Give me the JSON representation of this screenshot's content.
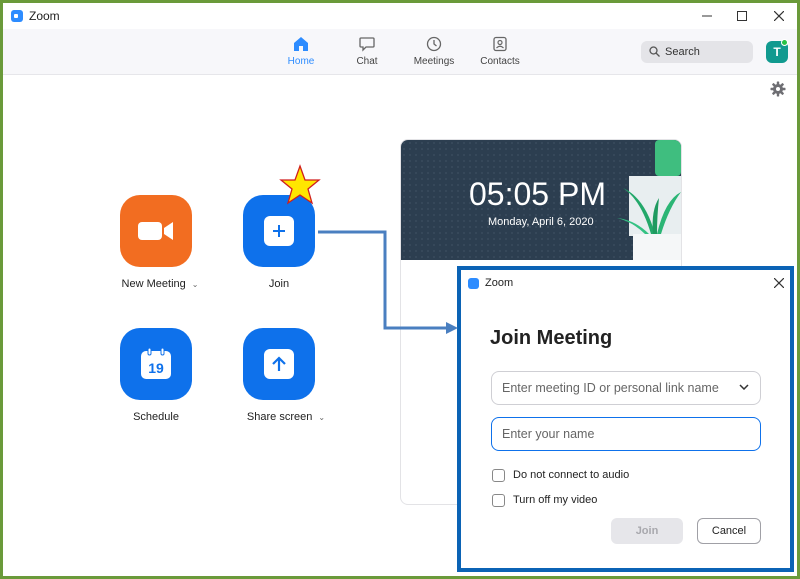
{
  "window": {
    "title": "Zoom",
    "controls": [
      "minimize-icon",
      "maximize-icon",
      "close-icon"
    ]
  },
  "nav": {
    "tabs": [
      {
        "label": "Home",
        "icon": "home-icon",
        "active": true
      },
      {
        "label": "Chat",
        "icon": "chat-icon",
        "active": false
      },
      {
        "label": "Meetings",
        "icon": "clock-icon",
        "active": false
      },
      {
        "label": "Contacts",
        "icon": "contacts-icon",
        "active": false
      }
    ],
    "search_placeholder": "Search",
    "avatar_initial": "T"
  },
  "actions": [
    {
      "label": "New Meeting",
      "icon": "video-camera-icon",
      "color": "#f26d21",
      "has_dropdown": true
    },
    {
      "label": "Join",
      "icon": "plus-icon",
      "color": "#0e71eb",
      "has_dropdown": false
    },
    {
      "label": "Schedule",
      "icon": "calendar-icon",
      "icon_text": "19",
      "color": "#0e71eb",
      "has_dropdown": false
    },
    {
      "label": "Share screen",
      "icon": "share-arrow-icon",
      "color": "#0e71eb",
      "has_dropdown": true
    }
  ],
  "clock": {
    "time": "05:05 PM",
    "date": "Monday, April 6, 2020"
  },
  "dialog": {
    "title": "Zoom",
    "heading": "Join Meeting",
    "meeting_id_placeholder": "Enter meeting ID or personal link name",
    "name_placeholder": "Enter your name",
    "options": [
      {
        "label": "Do not connect to audio",
        "checked": false
      },
      {
        "label": "Turn off my video",
        "checked": false
      }
    ],
    "join_label": "Join",
    "cancel_label": "Cancel"
  },
  "colors": {
    "accent": "#0e71eb",
    "orange": "#f26d21",
    "dialog_border": "#0b63b5",
    "annotation_arrow": "#4a7fc0",
    "annotation_star": "#ffe600",
    "frame_border": "#6a9a3a"
  }
}
